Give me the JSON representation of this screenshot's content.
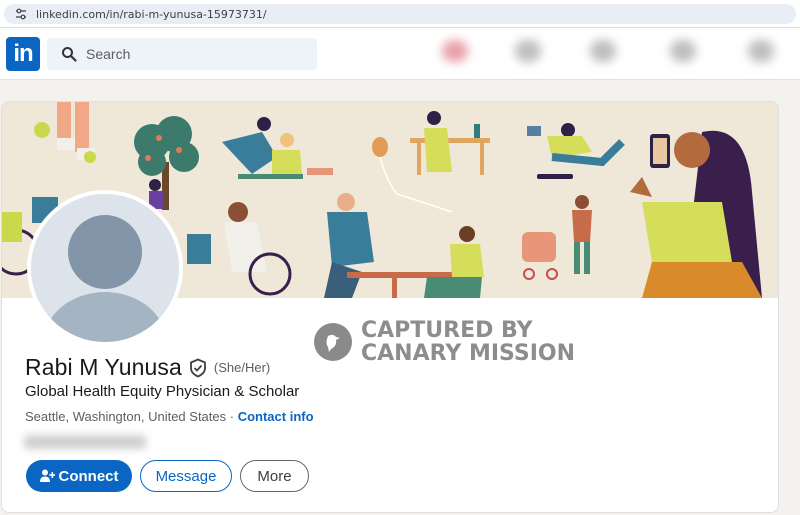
{
  "browser": {
    "url": "linkedin.com/in/rabi-m-yunusa-15973731/"
  },
  "nav": {
    "logo_text": "in",
    "search_placeholder": "Search"
  },
  "profile": {
    "name": "Rabi M Yunusa",
    "pronouns": "(She/Her)",
    "headline": "Global Health Equity Physician & Scholar",
    "location": "Seattle, Washington, United States",
    "separator": " · ",
    "contact_info_label": "Contact info"
  },
  "watermark": {
    "line1": "CAPTURED BY",
    "line2": "CANARY MISSION"
  },
  "actions": {
    "connect_label": "Connect",
    "message_label": "Message",
    "more_label": "More"
  },
  "colors": {
    "brand_blue": "#0a66c2",
    "banner_bg": "#efe7d8"
  },
  "icons": [
    "tune-icon",
    "search-icon",
    "verified-shield-icon",
    "add-person-icon",
    "bird-icon"
  ]
}
